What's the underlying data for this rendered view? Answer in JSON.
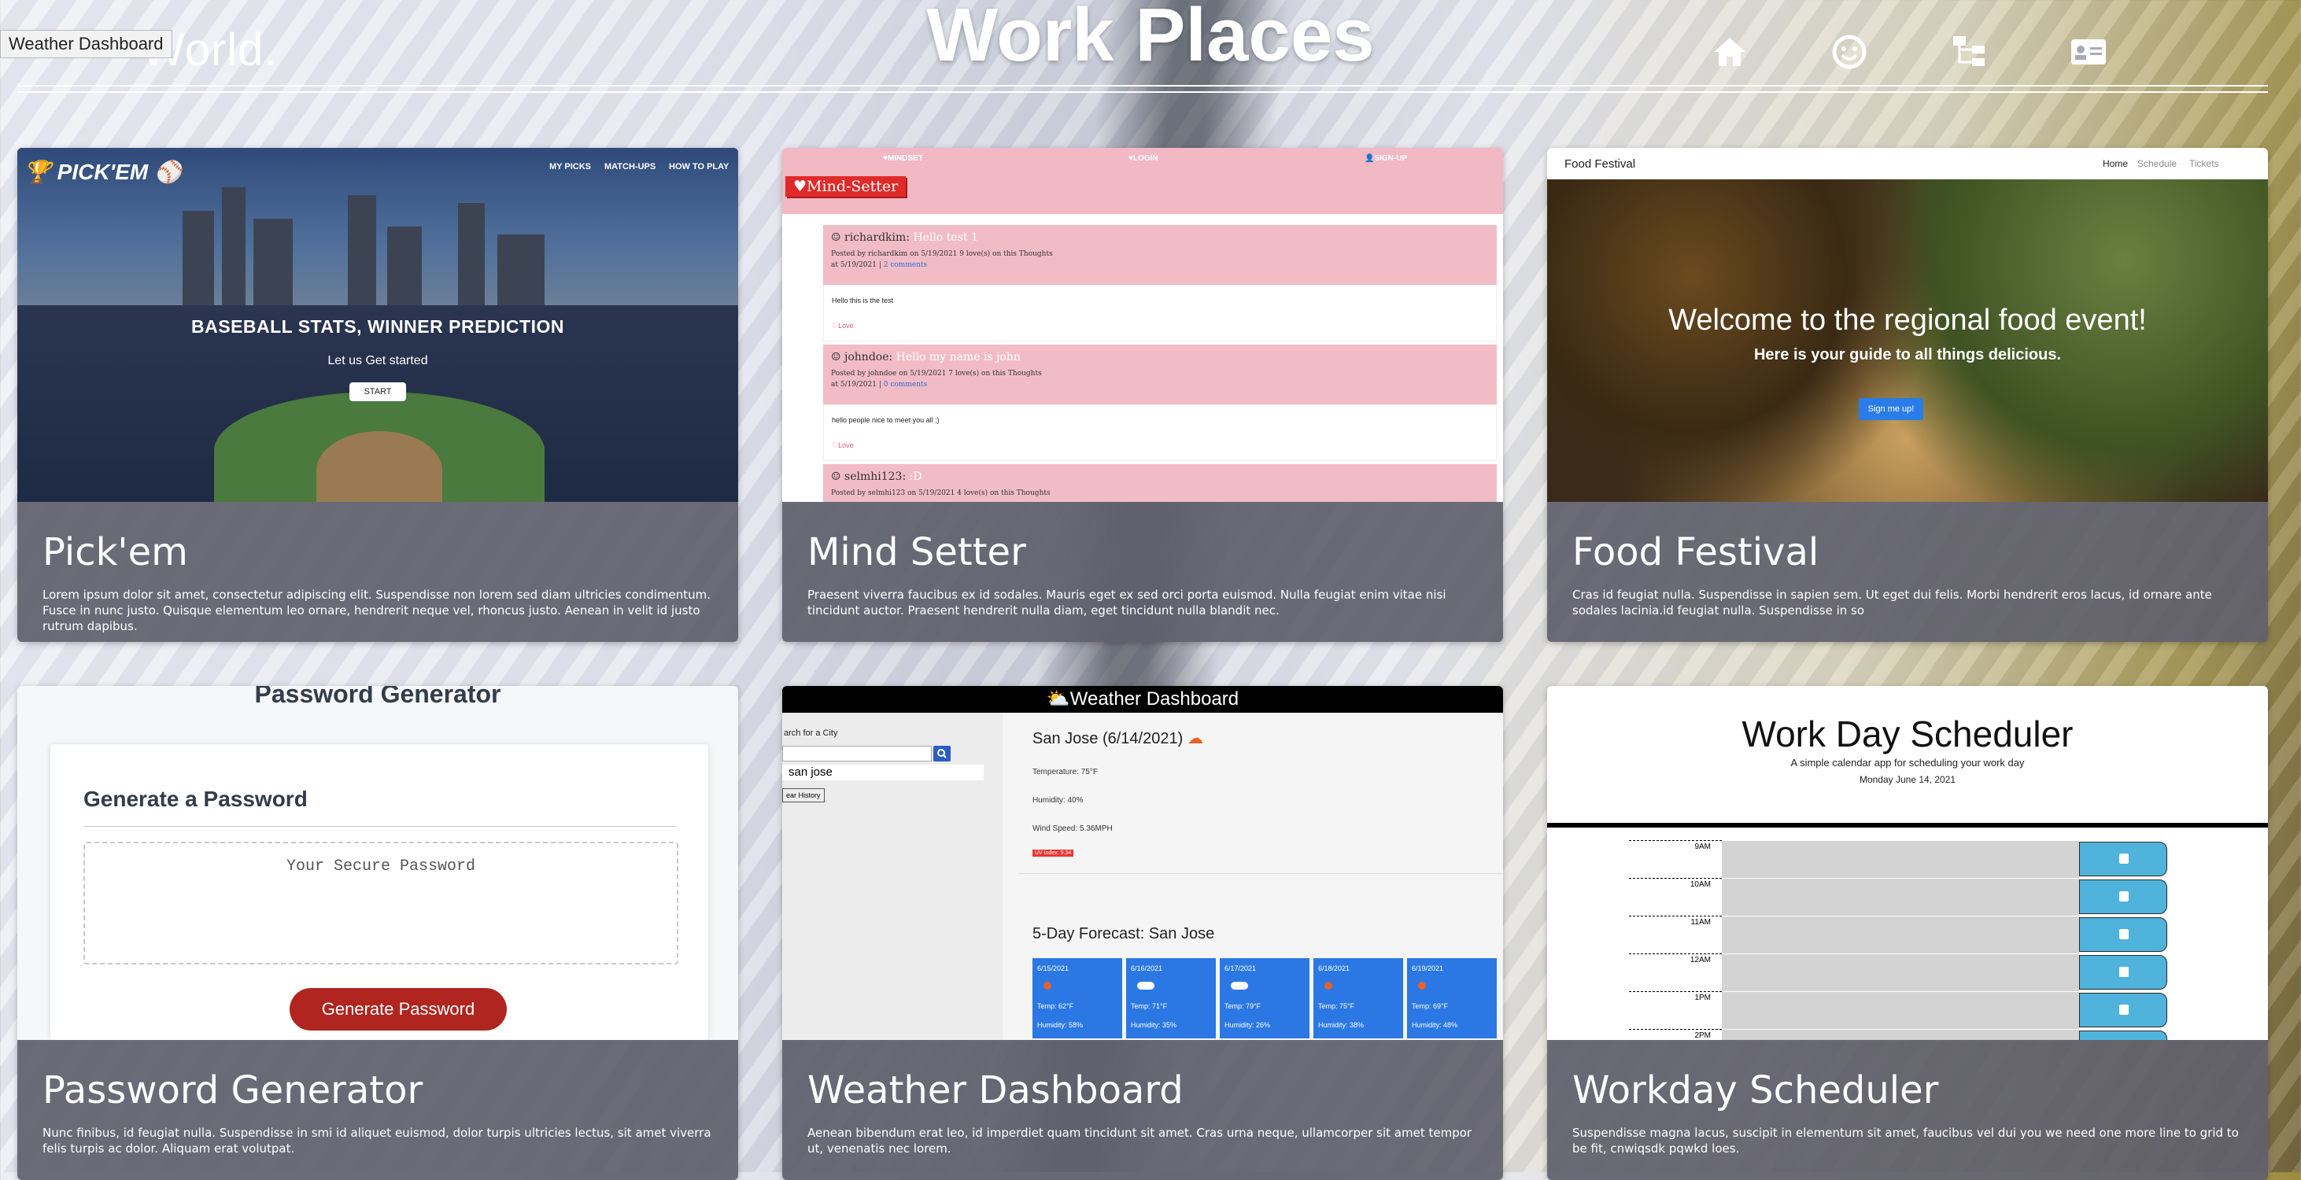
{
  "tooltip": "Weather Dashboard",
  "header": {
    "logo": "World.",
    "title": "Work Places",
    "nav_icons": [
      "home-icon",
      "smile-icon",
      "sitemap-icon",
      "id-card-icon"
    ]
  },
  "colors": {
    "caption_bg": "#5f606c",
    "accent_blue": "#2b78e4",
    "mind_pink": "#f2b8c4",
    "password_red": "#b0251f",
    "save_blue": "#4fb3db"
  },
  "projects": [
    {
      "title": "Pick'em",
      "description": "Lorem ipsum dolor sit amet, consectetur adipiscing elit. Suspendisse non lorem sed diam ultricies condimentum. Fusce in nunc justo. Quisque elementum leo ornare, hendrerit neque vel, rhoncus justo. Aenean in velit id justo rutrum dapibus.",
      "preview": {
        "logo": "PICK'EM",
        "nav": [
          "MY PICKS",
          "MATCH-UPS",
          "HOW TO PLAY"
        ],
        "headline": "BASEBALL STATS, WINNER PREDICTION",
        "subline": "Let us Get started",
        "button": "START"
      }
    },
    {
      "title": "Mind Setter",
      "description": "Praesent viverra faucibus ex id sodales. Mauris eget ex sed orci porta euismod. Nulla feugiat enim vitae nisi tincidunt auctor. Praesent hendrerit nulla diam, eget tincidunt nulla blandit nec.",
      "preview": {
        "nav": [
          "MINDSET",
          "LOGIN",
          "SIGN-UP"
        ],
        "brand": "Mind-Setter",
        "posts": [
          {
            "user": "richardkim:",
            "title": "Hello test 1",
            "meta1": "Posted by richardkim on 5/19/2021 9 love(s) on this Thoughts",
            "meta2": "at 5/19/2021 |",
            "comments": "2 comments",
            "body": "Hello this is the test",
            "love": "Love"
          },
          {
            "user": "johndoe:",
            "title": "Hello my name is john",
            "meta1": "Posted by johndoe on 5/19/2021 7 love(s) on this Thoughts",
            "meta2": "at 5/19/2021 |",
            "comments": "0 comments",
            "body": "hello people nice to meet you all ;)",
            "love": "Love"
          },
          {
            "user": "selmhi123:",
            "title": ":D",
            "meta1": "Posted by selmhi123 on 5/19/2021 4 love(s) on this Thoughts",
            "meta2": "",
            "comments": "",
            "body": "",
            "love": ""
          }
        ]
      }
    },
    {
      "title": "Food Festival",
      "description": "Cras id feugiat nulla. Suspendisse in sapien sem. Ut eget dui felis. Morbi hendrerit eros lacus, id ornare ante sodales lacinia.id feugiat nulla. Suspendisse in so",
      "preview": {
        "brand": "Food Festival",
        "nav": [
          "Home",
          "Schedule",
          "Tickets"
        ],
        "headline": "Welcome to the regional food event!",
        "subline": "Here is your guide to all things delicious.",
        "button": "Sign me up!"
      }
    },
    {
      "title": "Password Generator",
      "description": "Nunc finibus, id feugiat nulla. Suspendisse in smi id aliquet euismod, dolor turpis ultricies lectus, sit amet viverra felis turpis ac dolor. Aliquam erat volutpat.",
      "preview": {
        "header": "Password Generator",
        "card_title": "Generate a Password",
        "placeholder": "Your Secure Password",
        "button": "Generate Password"
      }
    },
    {
      "title": "Weather Dashboard",
      "description": "Aenean bibendum erat leo, id imperdiet quam tincidunt sit amet. Cras urna neque, ullamcorper sit amet tempor ut, venenatis nec lorem.",
      "preview": {
        "header": "Weather Dashboard",
        "search_label": "arch for a City",
        "history_item": "san jose",
        "clear_button": "ear History",
        "city": "San Jose (6/14/2021)",
        "temperature": "Temperature: 75°F",
        "humidity": "Humidity: 40%",
        "wind": "Wind Speed: 5.36MPH",
        "uv": "UV Index: 9.34",
        "forecast_title": "5-Day Forecast: San Jose",
        "forecast": [
          {
            "date": "6/15/2021",
            "temp": "Temp: 62°F",
            "humidity": "Humidity: 58%",
            "icon": "sun-icon"
          },
          {
            "date": "6/16/2021",
            "temp": "Temp: 71°F",
            "humidity": "Humidity: 35%",
            "icon": "cloud-icon"
          },
          {
            "date": "6/17/2021",
            "temp": "Temp: 79°F",
            "humidity": "Humidity: 26%",
            "icon": "cloud-icon"
          },
          {
            "date": "6/18/2021",
            "temp": "Temp: 75°F",
            "humidity": "Humidity: 38%",
            "icon": "sun-icon"
          },
          {
            "date": "6/19/2021",
            "temp": "Temp: 69°F",
            "humidity": "Humidity: 48%",
            "icon": "sun-icon"
          }
        ]
      }
    },
    {
      "title": "Workday Scheduler",
      "description": "Suspendisse magna lacus, suscipit in elementum sit amet, faucibus vel dui you we need one more line to grid to be fit, cnwiqsdk pqwkd loes.",
      "preview": {
        "header": "Work Day Scheduler",
        "subtitle": "A simple calendar app for scheduling your work day",
        "date": "Monday June 14, 2021",
        "hours": [
          "9AM",
          "10AM",
          "11AM",
          "12AM",
          "1PM",
          "2PM"
        ]
      }
    }
  ]
}
